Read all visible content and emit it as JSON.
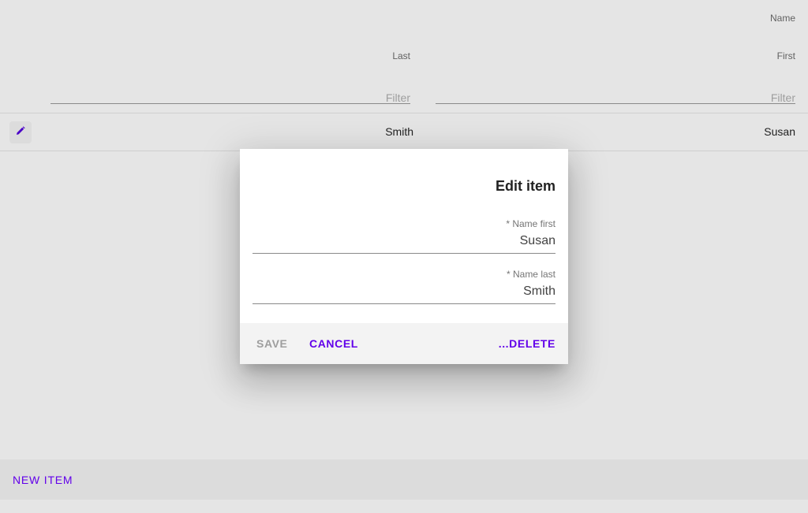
{
  "table": {
    "group_header": "Name",
    "columns": [
      {
        "label": "Last",
        "filter_placeholder": "Filter"
      },
      {
        "label": "First",
        "filter_placeholder": "Filter"
      }
    ],
    "rows": [
      {
        "last": "Smith",
        "first": "Susan",
        "edit_icon": "pencil-icon"
      }
    ]
  },
  "dialog": {
    "title": "Edit item",
    "fields": [
      {
        "label": "* Name first",
        "value": "Susan"
      },
      {
        "label": "* Name last",
        "value": "Smith"
      }
    ],
    "actions": {
      "save": "SAVE",
      "cancel": "CANCEL",
      "delete": "...DELETE"
    }
  },
  "footer": {
    "new_item": "NEW ITEM"
  },
  "colors": {
    "accent": "#6200ea",
    "disabled": "#9e9e9e",
    "background": "#e5e5e5"
  }
}
